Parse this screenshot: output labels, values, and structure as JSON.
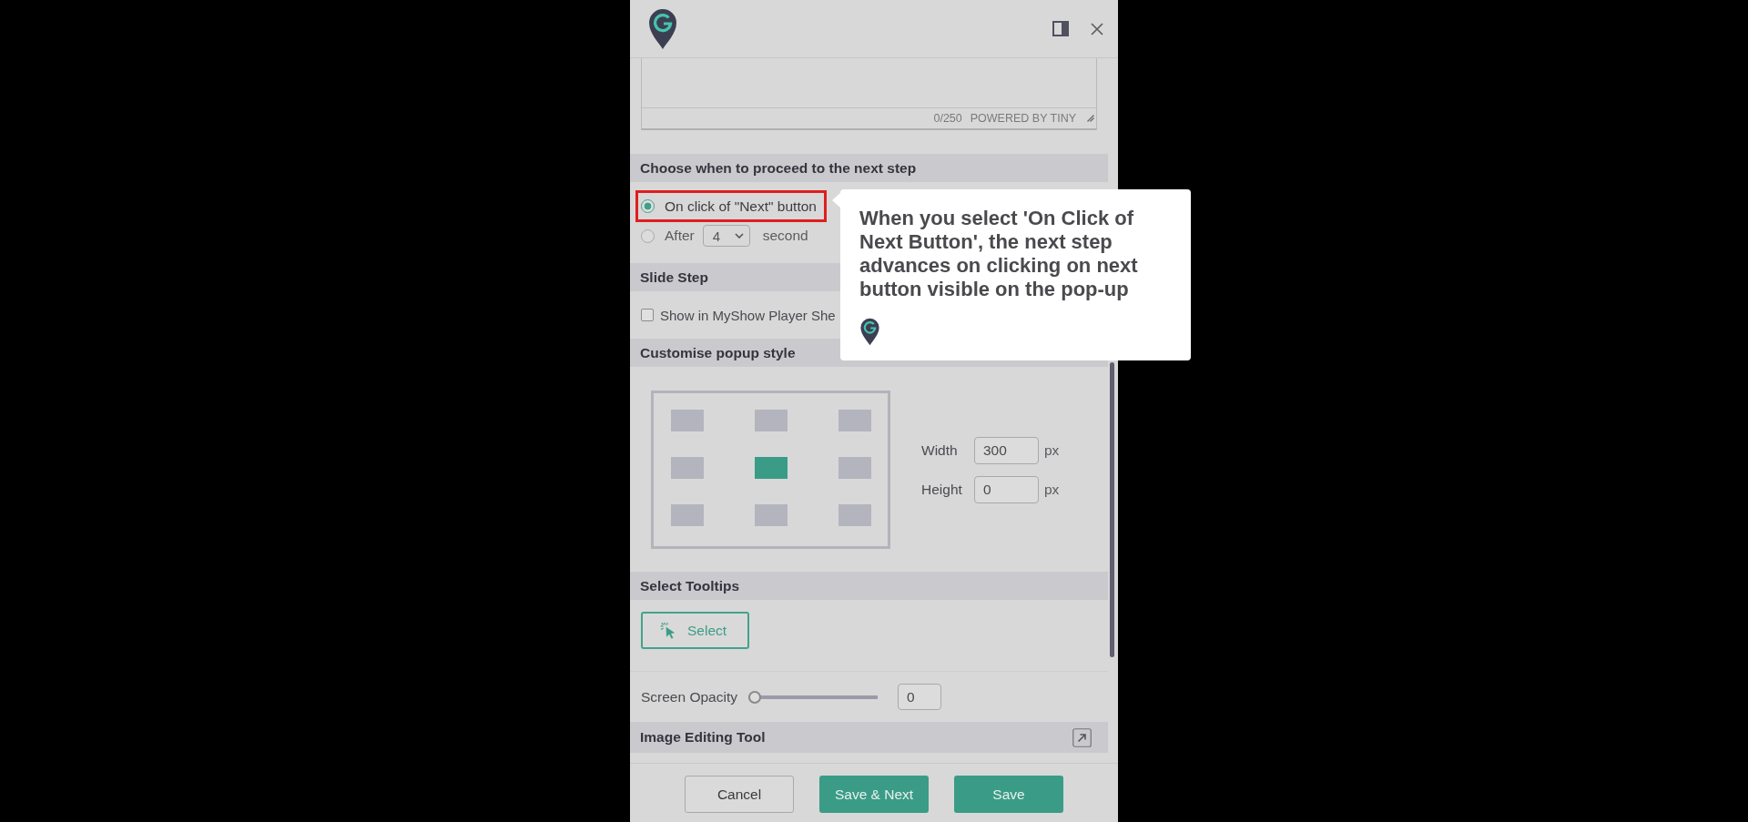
{
  "editor": {
    "counter": "0/250",
    "branding": "POWERED BY TINY"
  },
  "proceed": {
    "title": "Choose when to proceed to the next step",
    "options": [
      {
        "kind": "click",
        "label": "On click of \"Next\" button",
        "selected": true,
        "highlighted": true
      },
      {
        "kind": "timer",
        "label": "After",
        "value": "4",
        "unit": "second",
        "selected": false,
        "highlighted": false
      }
    ]
  },
  "slide_step": {
    "title": "Slide Step",
    "checkbox": {
      "label": "Show in MyShow Player She",
      "checked": false
    }
  },
  "popup_style": {
    "title": "Customise popup style",
    "positions": [
      {
        "selected": false
      },
      {
        "selected": false
      },
      {
        "selected": false
      },
      {
        "selected": false
      },
      {
        "selected": true
      },
      {
        "selected": false
      },
      {
        "selected": false
      },
      {
        "selected": false
      },
      {
        "selected": false
      }
    ],
    "fields": [
      {
        "label": "Width",
        "value": "300",
        "unit": "px"
      },
      {
        "label": "Height",
        "value": "0",
        "unit": "px"
      }
    ]
  },
  "tooltips": {
    "title": "Select Tooltips",
    "button": "Select"
  },
  "opacity": {
    "label": "Screen Opacity",
    "level": 0,
    "value": "0"
  },
  "image_tool": {
    "title": "Image Editing Tool"
  },
  "footer": {
    "buttons": [
      {
        "label": "Cancel",
        "kind": "secondary"
      },
      {
        "label": "Save & Next",
        "kind": "primary"
      },
      {
        "label": "Save",
        "kind": "primary"
      }
    ]
  },
  "tooltip": {
    "text": "When you select 'On Click of Next Button', the next step advances on clicking on next button visible on the pop-up"
  }
}
